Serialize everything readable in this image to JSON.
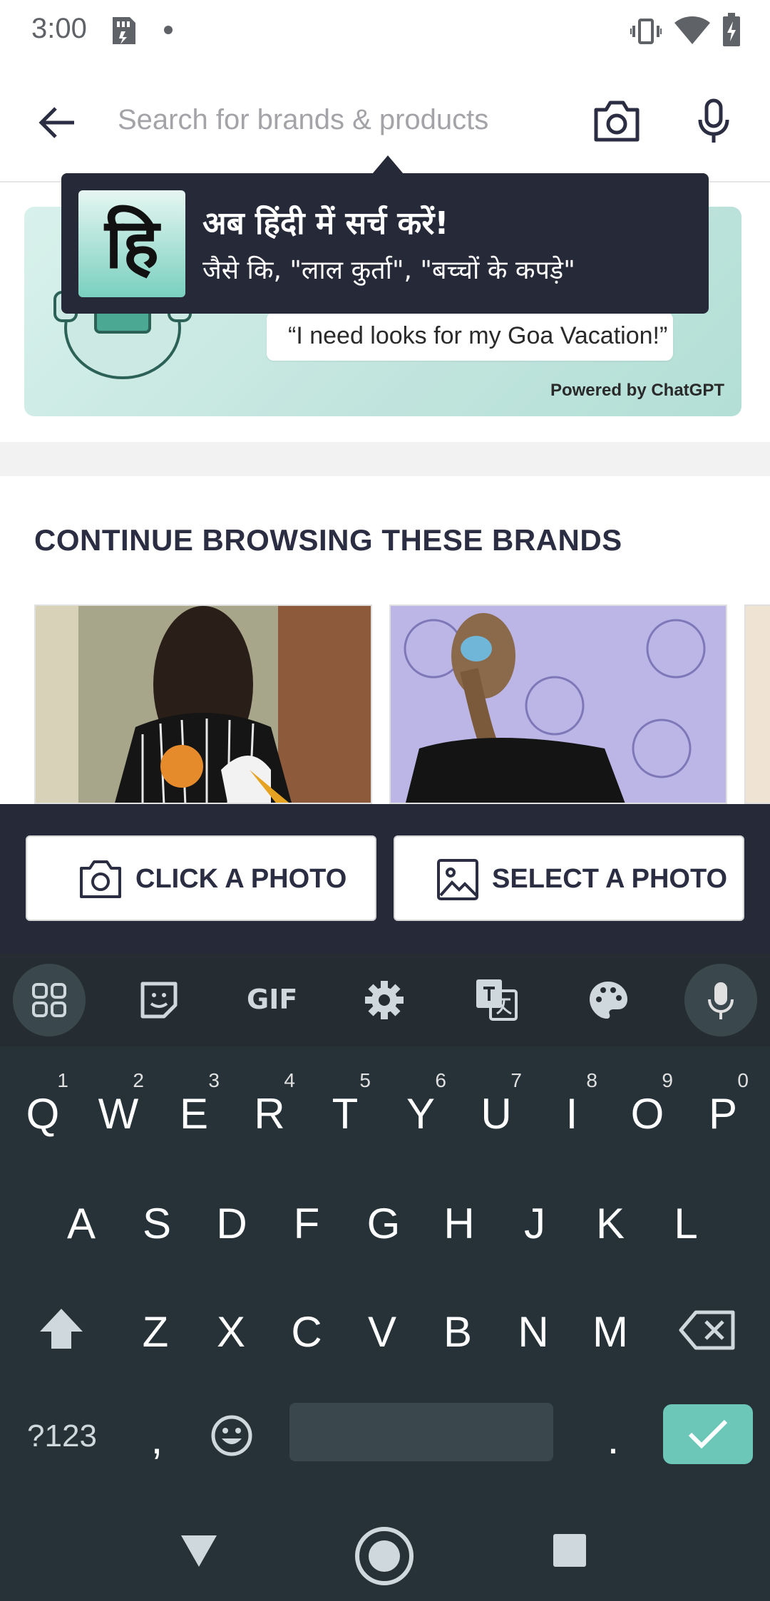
{
  "status_bar": {
    "time": "3:00"
  },
  "search": {
    "placeholder": "Search for brands & products"
  },
  "banner": {
    "quote": "“I need looks for my Goa Vacation!”",
    "powered_by": "Powered by ChatGPT"
  },
  "tooltip": {
    "badge": "हि",
    "title": "अब हिंदी में सर्च करें!",
    "subtitle": "जैसे कि, \"लाल कुर्ता\", \"बच्चों के कपड़े\""
  },
  "section": {
    "title": "CONTINUE BROWSING THESE BRANDS"
  },
  "photo_actions": {
    "click_label": "CLICK A PHOTO",
    "select_label": "SELECT A PHOTO"
  },
  "keyboard": {
    "toolbar_gif": "GIF",
    "row1": [
      {
        "k": "Q",
        "h": "1"
      },
      {
        "k": "W",
        "h": "2"
      },
      {
        "k": "E",
        "h": "3"
      },
      {
        "k": "R",
        "h": "4"
      },
      {
        "k": "T",
        "h": "5"
      },
      {
        "k": "Y",
        "h": "6"
      },
      {
        "k": "U",
        "h": "7"
      },
      {
        "k": "I",
        "h": "8"
      },
      {
        "k": "O",
        "h": "9"
      },
      {
        "k": "P",
        "h": "0"
      }
    ],
    "row2": [
      "A",
      "S",
      "D",
      "F",
      "G",
      "H",
      "J",
      "K",
      "L"
    ],
    "row3": [
      "Z",
      "X",
      "C",
      "V",
      "B",
      "N",
      "M"
    ],
    "symbols_label": "?123",
    "comma": ",",
    "period": "."
  },
  "colors": {
    "header_dark": "#262938",
    "accent_teal": "#6cc7b8",
    "keyboard_bg": "#263238"
  }
}
